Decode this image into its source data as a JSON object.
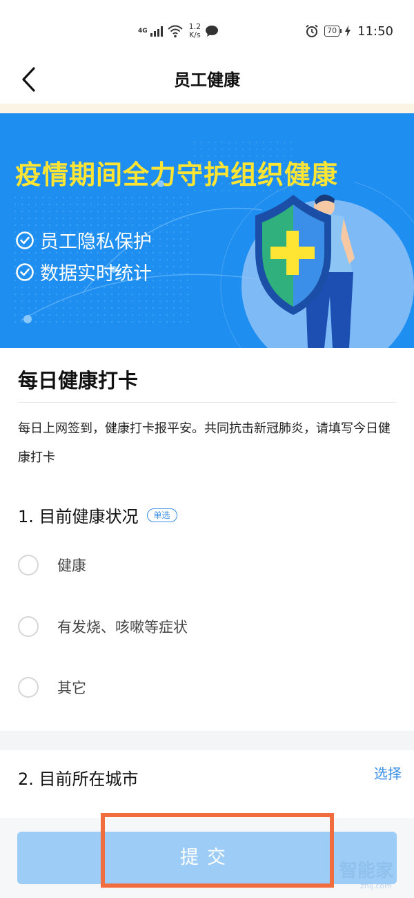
{
  "status_bar": {
    "network": "4G",
    "speed_value": "1.2",
    "speed_unit": "K/s",
    "battery": "70",
    "time": "11:50"
  },
  "nav": {
    "title": "员工健康"
  },
  "banner": {
    "title": "疫情期间全力守护组织健康",
    "features": [
      "员工隐私保护",
      "数据实时统计"
    ]
  },
  "form": {
    "title": "每日健康打卡",
    "description": "每日上网签到，健康打卡报平安。共同抗击新冠肺炎，请填写今日健康打卡",
    "question1": {
      "title": "1. 目前健康状况",
      "badge": "单选",
      "options": [
        "健康",
        "有发烧、咳嗽等症状",
        "其它"
      ]
    },
    "question2": {
      "title": "2. 目前所在城市",
      "action": "选择"
    }
  },
  "submit": {
    "label": "提交"
  },
  "colors": {
    "accent": "#3a8ee6",
    "banner_bg": "#1e8ef0",
    "banner_title": "#ffe533",
    "submit_bg": "#9dcdf6",
    "highlight": "#f26d3d"
  },
  "watermark": {
    "text": "智能家",
    "sub": "zhij.com"
  }
}
